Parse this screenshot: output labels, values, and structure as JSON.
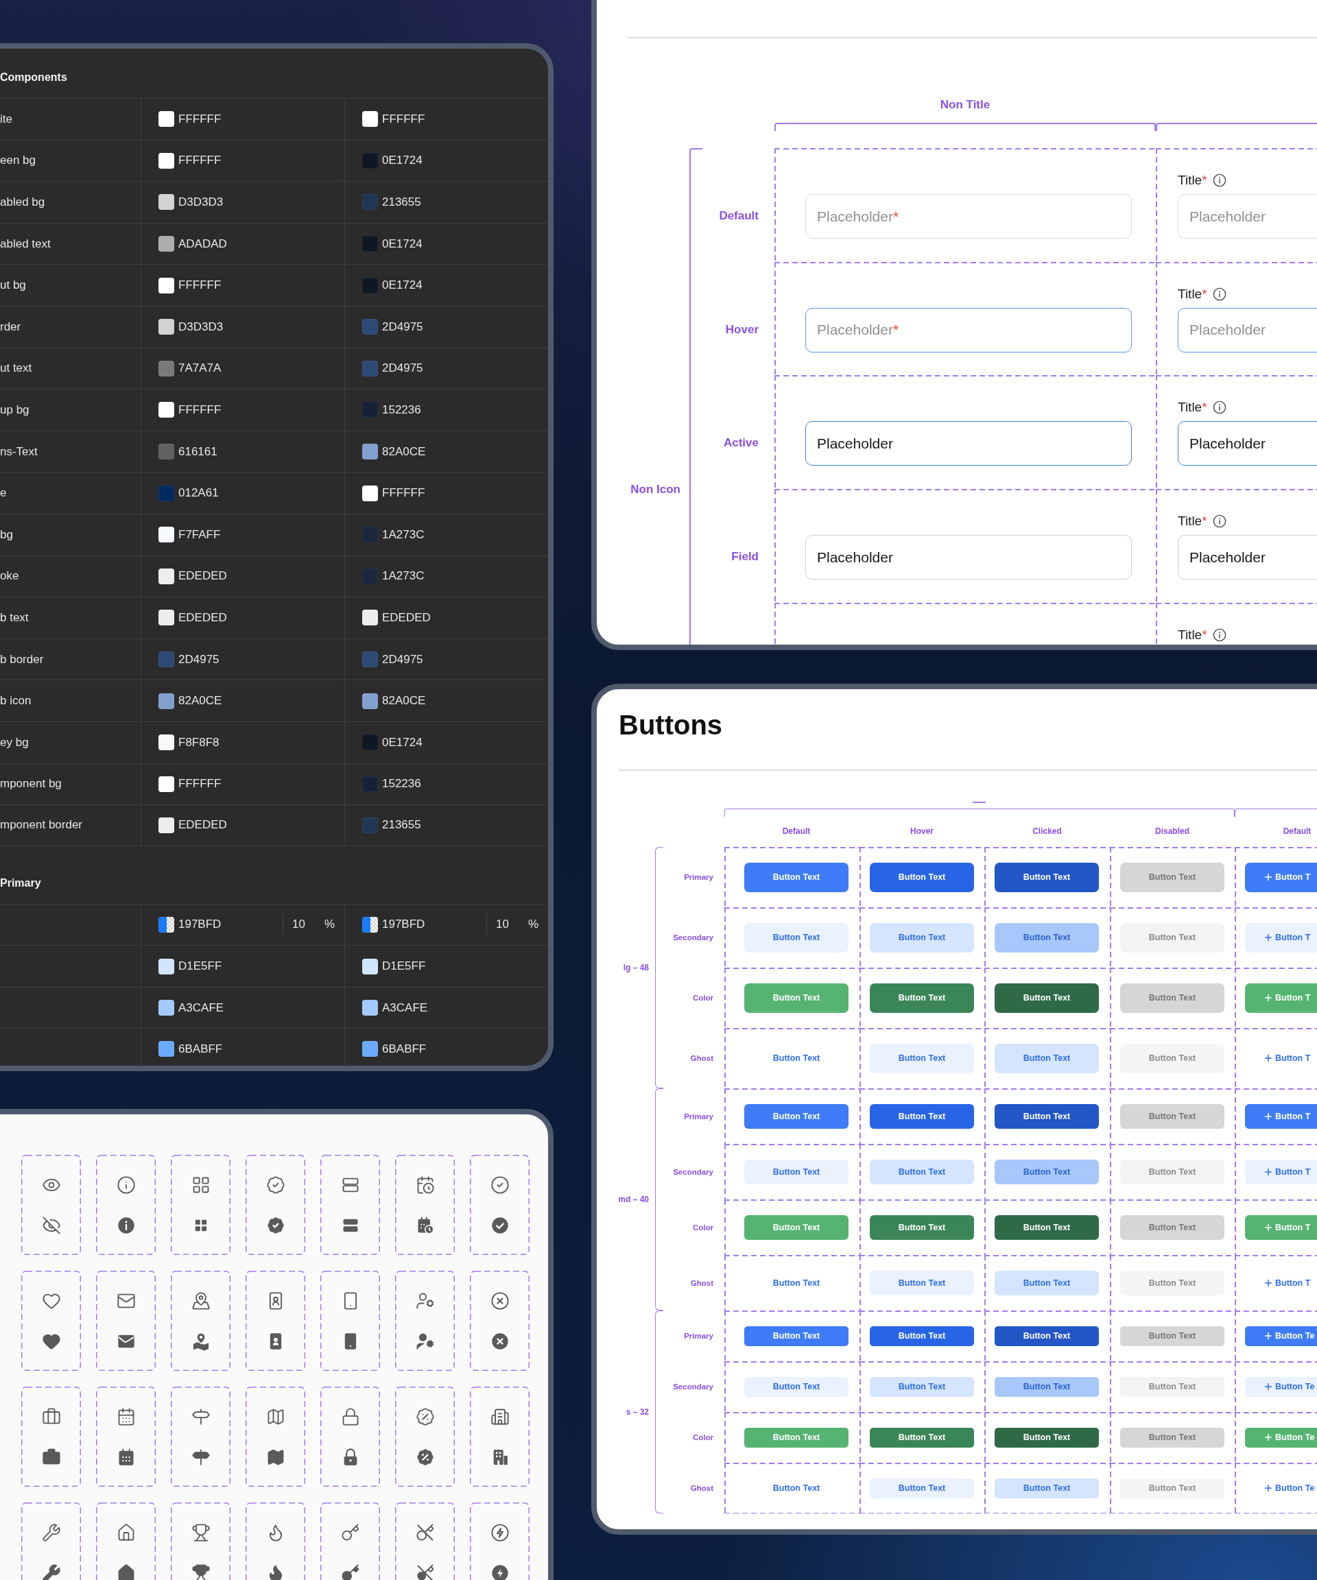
{
  "color_table": {
    "sections": [
      {
        "title": "Components",
        "rows": [
          {
            "label": "ite",
            "kind": "solid",
            "column_2": {
              "hex": "FFFFFF",
              "color": "#ffffff"
            },
            "column_3": {
              "hex": "FFFFFF",
              "color": "#ffffff"
            }
          },
          {
            "label": "een bg",
            "kind": "solid",
            "column_2": {
              "hex": "FFFFFF",
              "color": "#ffffff"
            },
            "column_3": {
              "hex": "0E1724",
              "color": "#0e1724"
            }
          },
          {
            "label": "abled bg",
            "kind": "solid",
            "column_2": {
              "hex": "D3D3D3",
              "color": "#d3d3d3"
            },
            "column_3": {
              "hex": "213655",
              "color": "#213655"
            }
          },
          {
            "label": "abled text",
            "kind": "solid",
            "column_2": {
              "hex": "ADADAD",
              "color": "#adadad"
            },
            "column_3": {
              "hex": "0E1724",
              "color": "#0e1724"
            }
          },
          {
            "label": "ut bg",
            "kind": "solid",
            "column_2": {
              "hex": "FFFFFF",
              "color": "#ffffff"
            },
            "column_3": {
              "hex": "0E1724",
              "color": "#0e1724"
            }
          },
          {
            "label": "rder",
            "kind": "solid",
            "column_2": {
              "hex": "D3D3D3",
              "color": "#d3d3d3"
            },
            "column_3": {
              "hex": "2D4975",
              "color": "#2d4975"
            }
          },
          {
            "label": "ut text",
            "kind": "solid",
            "column_2": {
              "hex": "7A7A7A",
              "color": "#7a7a7a"
            },
            "column_3": {
              "hex": "2D4975",
              "color": "#2d4975"
            }
          },
          {
            "label": "up bg",
            "kind": "solid",
            "column_2": {
              "hex": "FFFFFF",
              "color": "#ffffff"
            },
            "column_3": {
              "hex": "152236",
              "color": "#152236"
            }
          },
          {
            "label": "ns-Text",
            "kind": "solid",
            "column_2": {
              "hex": "616161",
              "color": "#616161"
            },
            "column_3": {
              "hex": "82A0CE",
              "color": "#82a0ce"
            }
          },
          {
            "label": "e",
            "kind": "solid",
            "column_2": {
              "hex": "012A61",
              "color": "#012a61"
            },
            "column_3": {
              "hex": "FFFFFF",
              "color": "#ffffff"
            }
          },
          {
            "label": "bg",
            "kind": "solid",
            "column_2": {
              "hex": "F7FAFF",
              "color": "#f7faff"
            },
            "column_3": {
              "hex": "1A273C",
              "color": "#1a273c"
            }
          },
          {
            "label": "oke",
            "kind": "solid",
            "column_2": {
              "hex": "EDEDED",
              "color": "#ededed"
            },
            "column_3": {
              "hex": "1A273C",
              "color": "#1a273c"
            }
          },
          {
            "label": "b text",
            "kind": "solid",
            "column_2": {
              "hex": "EDEDED",
              "color": "#ededed"
            },
            "column_3": {
              "hex": "EDEDED",
              "color": "#ededed"
            }
          },
          {
            "label": "b border",
            "kind": "solid",
            "column_2": {
              "hex": "2D4975",
              "color": "#2d4975"
            },
            "column_3": {
              "hex": "2D4975",
              "color": "#2d4975"
            }
          },
          {
            "label": "b icon",
            "kind": "solid",
            "column_2": {
              "hex": "82A0CE",
              "color": "#82a0ce"
            },
            "column_3": {
              "hex": "82A0CE",
              "color": "#82a0ce"
            }
          },
          {
            "label": "ey bg",
            "kind": "solid",
            "column_2": {
              "hex": "F8F8F8",
              "color": "#f8f8f8"
            },
            "column_3": {
              "hex": "0E1724",
              "color": "#0e1724"
            }
          },
          {
            "label": "mponent bg",
            "kind": "solid",
            "column_2": {
              "hex": "FFFFFF",
              "color": "#ffffff"
            },
            "column_3": {
              "hex": "152236",
              "color": "#152236"
            }
          },
          {
            "label": "mponent border",
            "kind": "solid",
            "column_2": {
              "hex": "EDEDED",
              "color": "#ededed"
            },
            "column_3": {
              "hex": "213655",
              "color": "#213655"
            }
          }
        ]
      },
      {
        "title": "Primary",
        "rows": [
          {
            "kind": "alpha",
            "column_2": {
              "hex": "197BFD",
              "color": "#197bfd",
              "opacity": "10",
              "unit": "%"
            },
            "column_3": {
              "hex": "197BFD",
              "color": "#197bfd",
              "opacity": "10",
              "unit": "%"
            }
          },
          {
            "kind": "solid",
            "column_2": {
              "hex": "D1E5FF",
              "color": "#d1e5ff"
            },
            "column_3": {
              "hex": "D1E5FF",
              "color": "#d1e5ff"
            }
          },
          {
            "kind": "solid",
            "column_2": {
              "hex": "A3CAFE",
              "color": "#a3cafe"
            },
            "column_3": {
              "hex": "A3CAFE",
              "color": "#a3cafe"
            }
          },
          {
            "kind": "solid",
            "column_2": {
              "hex": "6BABFF",
              "color": "#6babff"
            },
            "column_3": {
              "hex": "6BABFF",
              "color": "#6babff"
            }
          }
        ]
      }
    ]
  },
  "input_panel": {
    "column_header": "Non Title",
    "group_label": "Non Icon",
    "rows": [
      {
        "label": "Default",
        "kind": "default",
        "plain_field": {
          "placeholder": "Placeholder",
          "required_mark": "*"
        },
        "titled_field": {
          "title": "Title",
          "required_mark": "*",
          "field": {
            "placeholder": "Placeholder"
          }
        }
      },
      {
        "label": "Hover",
        "kind": "hover",
        "plain_field": {
          "placeholder": "Placeholder",
          "required_mark": "*"
        },
        "titled_field": {
          "title": "Title",
          "required_mark": "*",
          "field": {
            "placeholder": "Placeholder"
          }
        }
      },
      {
        "label": "Active",
        "kind": "active",
        "plain_field": {
          "value": "Placeholder"
        },
        "titled_field": {
          "title": "Title",
          "required_mark": "*",
          "field": {
            "value": "Placeholder"
          }
        }
      },
      {
        "label": "Field",
        "kind": "filled",
        "plain_field": {
          "value": "Placeholder"
        },
        "titled_field": {
          "title": "Title",
          "required_mark": "*",
          "field": {
            "value": "Placeholder"
          }
        }
      },
      {
        "titled_field": {
          "title": "Title",
          "required_mark": "*"
        }
      }
    ]
  },
  "buttons_panel": {
    "title": "Buttons",
    "columns": [
      {
        "label": "Default",
        "kind": "default",
        "icon": false
      },
      {
        "label": "Hover",
        "kind": "hover",
        "icon": false
      },
      {
        "label": "Clicked",
        "kind": "clicked",
        "icon": false
      },
      {
        "label": "Disabled",
        "kind": "disabled",
        "icon": false
      },
      {
        "label": "Default",
        "kind": "default",
        "icon": true
      }
    ],
    "groups": [
      {
        "label": "lg – 48",
        "kind": "lg",
        "rows": [
          {
            "label": "Primary",
            "kind": "primary",
            "buttons": [
              "Button Text",
              "Button Text",
              "Button Text",
              "Button Text",
              "Button T"
            ]
          },
          {
            "label": "Secondary",
            "kind": "secondary",
            "buttons": [
              "Button Text",
              "Button Text",
              "Button Text",
              "Button Text",
              "Button T"
            ]
          },
          {
            "label": "Color",
            "kind": "color",
            "buttons": [
              "Button Text",
              "Button Text",
              "Button Text",
              "Button Text",
              "Button T"
            ]
          },
          {
            "label": "Ghost",
            "kind": "ghost",
            "buttons": [
              "Button Text",
              "Button Text",
              "Button Text",
              "Button Text",
              "Button T"
            ]
          }
        ]
      },
      {
        "label": "md – 40",
        "kind": "md",
        "rows": [
          {
            "label": "Primary",
            "kind": "primary",
            "buttons": [
              "Button Text",
              "Button Text",
              "Button Text",
              "Button Text",
              "Button T"
            ]
          },
          {
            "label": "Secondary",
            "kind": "secondary",
            "buttons": [
              "Button Text",
              "Button Text",
              "Button Text",
              "Button Text",
              "Button T"
            ]
          },
          {
            "label": "Color",
            "kind": "color",
            "buttons": [
              "Button Text",
              "Button Text",
              "Button Text",
              "Button Text",
              "Button T"
            ]
          },
          {
            "label": "Ghost",
            "kind": "ghost",
            "buttons": [
              "Button Text",
              "Button Text",
              "Button Text",
              "Button Text",
              "Button T"
            ]
          }
        ]
      },
      {
        "label": "s – 32",
        "kind": "s",
        "rows": [
          {
            "label": "Primary",
            "kind": "primary",
            "buttons": [
              "Button Text",
              "Button Text",
              "Button Text",
              "Button Text",
              "Button Te"
            ]
          },
          {
            "label": "Secondary",
            "kind": "secondary",
            "buttons": [
              "Button Text",
              "Button Text",
              "Button Text",
              "Button Text",
              "Button Te"
            ]
          },
          {
            "label": "Color",
            "kind": "color",
            "buttons": [
              "Button Text",
              "Button Text",
              "Button Text",
              "Button Text",
              "Button Te"
            ]
          },
          {
            "label": "Ghost",
            "kind": "ghost",
            "buttons": [
              "Button Text",
              "Button Text",
              "Button Text",
              "Button Text",
              "Button Te"
            ]
          }
        ]
      }
    ]
  }
}
